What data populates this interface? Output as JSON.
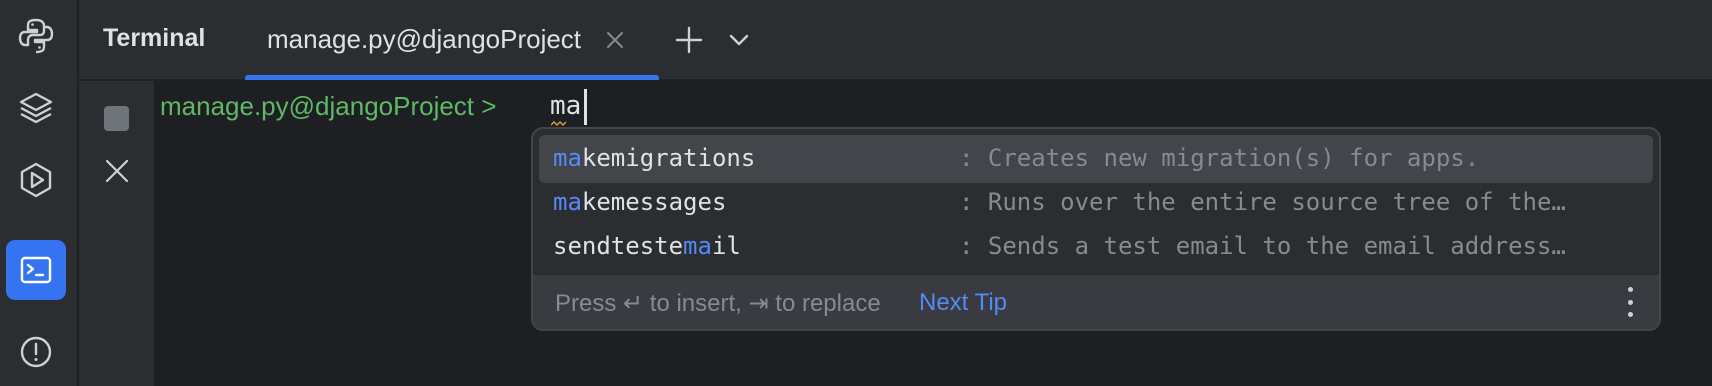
{
  "toolstrip": {
    "items": [
      {
        "name": "python-console",
        "icon": "python-icon",
        "active": false
      },
      {
        "name": "python-packages",
        "icon": "layers-icon",
        "active": false
      },
      {
        "name": "services",
        "icon": "services-icon",
        "active": false
      },
      {
        "name": "terminal",
        "icon": "terminal-icon",
        "active": true
      },
      {
        "name": "problems",
        "icon": "problems-icon",
        "active": false
      }
    ]
  },
  "header": {
    "title": "Terminal",
    "tab_label": "manage.py@djangoProject",
    "close_icon": "close-icon",
    "add_icon": "plus-icon",
    "dropdown_icon": "chevron-down-icon"
  },
  "terminal": {
    "prompt": "manage.py@djangoProject >",
    "typed": "ma"
  },
  "completion": {
    "items": [
      {
        "prefix": "",
        "match": "ma",
        "suffix": "kemigrations",
        "description": ": Creates new migration(s) for apps.",
        "selected": true
      },
      {
        "prefix": "",
        "match": "ma",
        "suffix": "kemessages",
        "description": ": Runs over the entire source tree of the…",
        "selected": false
      },
      {
        "prefix": "sendteste",
        "match": "ma",
        "suffix": "il",
        "description": ": Sends a test email to the email address…",
        "selected": false
      }
    ],
    "footer_hint": "Press ↵ to insert, ⇥ to replace",
    "footer_tip": "Next Tip"
  },
  "colors": {
    "accent": "#3574f0",
    "prompt_green": "#5fb865",
    "match_blue": "#548af7"
  }
}
